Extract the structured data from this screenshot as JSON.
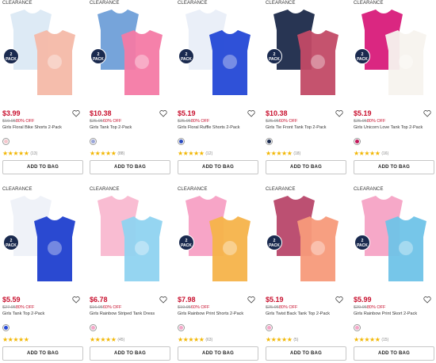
{
  "products": [
    {
      "badge": "CLEARANCE",
      "pack": [
        "2",
        "PACK"
      ],
      "price": "$3.99",
      "was_price": "$19.95",
      "discount": "80% OFF",
      "name": "Girls Floral Bike Shorts 2-Pack",
      "rating_count": "(13)",
      "button": "ADD TO BAG",
      "swatch": "#f4c6cc",
      "colors": [
        "#dbe9f4",
        "#f4b9a8"
      ]
    },
    {
      "badge": "CLEARANCE",
      "pack": [
        "2",
        "PACK"
      ],
      "price": "$10.38",
      "was_price": "$25.95",
      "discount": "60% OFF",
      "name": "Girls Tank Top 2-Pack",
      "rating_count": "(88)",
      "button": "ADD TO BAG",
      "swatch": "#9aa6d8",
      "colors": [
        "#6f9fd8",
        "#f47aa5"
      ]
    },
    {
      "badge": "CLEARANCE",
      "pack": [
        "2",
        "PACK"
      ],
      "price": "$5.19",
      "was_price": "$25.95",
      "discount": "80% OFF",
      "name": "Girls Floral Ruffle Shorts 2-Pack",
      "rating_count": "(12)",
      "button": "ADD TO BAG",
      "swatch": "#2a4bbf",
      "colors": [
        "#e9eef8",
        "#2448d6"
      ]
    },
    {
      "badge": "CLEARANCE",
      "pack": [
        "2",
        "PACK"
      ],
      "price": "$10.38",
      "was_price": "$25.95",
      "discount": "60% OFF",
      "name": "Girls Tie Front Tank Top 2-Pack",
      "rating_count": "(18)",
      "button": "ADD TO BAG",
      "swatch": "#1a2a4f",
      "colors": [
        "#1c2a4a",
        "#c24a66"
      ]
    },
    {
      "badge": "CLEARANCE",
      "pack": [
        "2",
        "PACK"
      ],
      "price": "$5.19",
      "was_price": "$25.95",
      "discount": "80% OFF",
      "name": "Girls Unicorn Love Tank Top 2-Pack",
      "rating_count": "(16)",
      "button": "ADD TO BAG",
      "swatch": "#c2185b",
      "colors": [
        "#d81b7a",
        "#f7f3ee"
      ]
    },
    {
      "badge": "CLEARANCE",
      "pack": [
        "2",
        "PACK"
      ],
      "price": "$5.59",
      "was_price": "$27.95",
      "discount": "80% OFF",
      "name": "Girls Tank Top 2-Pack",
      "rating_count": "",
      "button": "ADD TO BAG",
      "swatch": "#2448d6",
      "colors": [
        "#eef1f8",
        "#1f3fcf"
      ]
    },
    {
      "badge": "CLEARANCE",
      "pack": null,
      "price": "$6.78",
      "was_price": "$16.95",
      "discount": "60% OFF",
      "name": "Girls Rainbow Striped Tank Dress",
      "rating_count": "(45)",
      "button": "ADD TO BAG",
      "swatch": "#f4a6c8",
      "colors": [
        "#f9b8d0",
        "#8fd3f0"
      ]
    },
    {
      "badge": "CLEARANCE",
      "pack": [
        "2",
        "PACK"
      ],
      "price": "$7.98",
      "was_price": "$19.95",
      "discount": "60% OFF",
      "name": "Girls Rainbow Print Shorts 2-Pack",
      "rating_count": "(63)",
      "button": "ADD TO BAG",
      "swatch": "#f4a6c8",
      "colors": [
        "#f7a0c4",
        "#f6b34a"
      ]
    },
    {
      "badge": "CLEARANCE",
      "pack": [
        "2",
        "PACK"
      ],
      "price": "$5.19",
      "was_price": "$25.95",
      "discount": "80% OFF",
      "name": "Girls Twist Back Tank Top 2-Pack",
      "rating_count": "(5)",
      "button": "ADD TO BAG",
      "swatch": "#f4a6c8",
      "colors": [
        "#b8476a",
        "#f79a7a"
      ]
    },
    {
      "badge": "CLEARANCE",
      "pack": [
        "2",
        "PACK"
      ],
      "price": "$5.99",
      "was_price": "$29.95",
      "discount": "80% OFF",
      "name": "Girls Rainbow Print Skort 2-Pack",
      "rating_count": "(15)",
      "button": "ADD TO BAG",
      "swatch": "#f4a6c8",
      "colors": [
        "#f6a3c5",
        "#6fc3e8"
      ]
    }
  ]
}
